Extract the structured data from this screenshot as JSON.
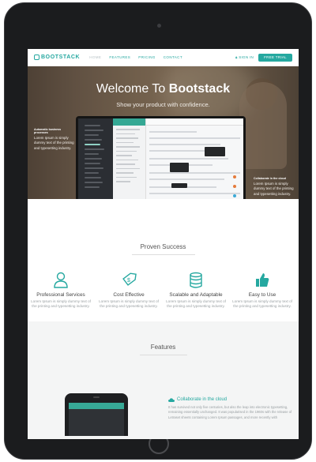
{
  "nav": {
    "logo": "BOOTSTACK",
    "items": [
      "HOME",
      "FEATURES",
      "PRICING",
      "CONTACT"
    ],
    "signin": "SIGN IN",
    "trial": "FREE TRIAL"
  },
  "hero": {
    "title_light": "Welcome To",
    "title_bold": "Bootstack",
    "subtitle": "Show your product with confidence.",
    "left_callout": {
      "title": "Automatic business processes",
      "body": "Lorem Ipsum is simply dummy text of the printing and typesetting industry."
    },
    "right_callout": {
      "title": "Collaborate in the cloud",
      "body": "Lorem Ipsum is simply dummy text of the printing and typesetting industry."
    }
  },
  "proven": {
    "title": "Proven Success",
    "items": [
      {
        "icon": "person-icon",
        "title": "Professional Services",
        "desc": "Lorem Ipsum is simply dummy text of the printing and typesetting industry."
      },
      {
        "icon": "price-tag-icon",
        "title": "Cost Effective",
        "desc": "Lorem Ipsum is simply dummy text of the printing and typesetting industry."
      },
      {
        "icon": "database-icon",
        "title": "Scalable and Adaptable",
        "desc": "Lorem Ipsum is simply dummy text of the printing and typesetting industry."
      },
      {
        "icon": "thumbs-up-icon",
        "title": "Easy to Use",
        "desc": "Lorem Ipsum is simply dummy text of the printing and typesetting industry."
      }
    ]
  },
  "features": {
    "title": "Features",
    "cloud_title": "Collaborate in the cloud",
    "cloud_desc": "It has survived not only five centuries, but also the leap into electronic typesetting, remaining essentially unchanged. It was popularised in the 1960s with the release of Letraset sheets containing Lorem Ipsum passages, and more recently with"
  },
  "colors": {
    "accent": "#25a8a0",
    "hero_overlay": "#2d261e",
    "features_bg": "#f4f5f5"
  }
}
